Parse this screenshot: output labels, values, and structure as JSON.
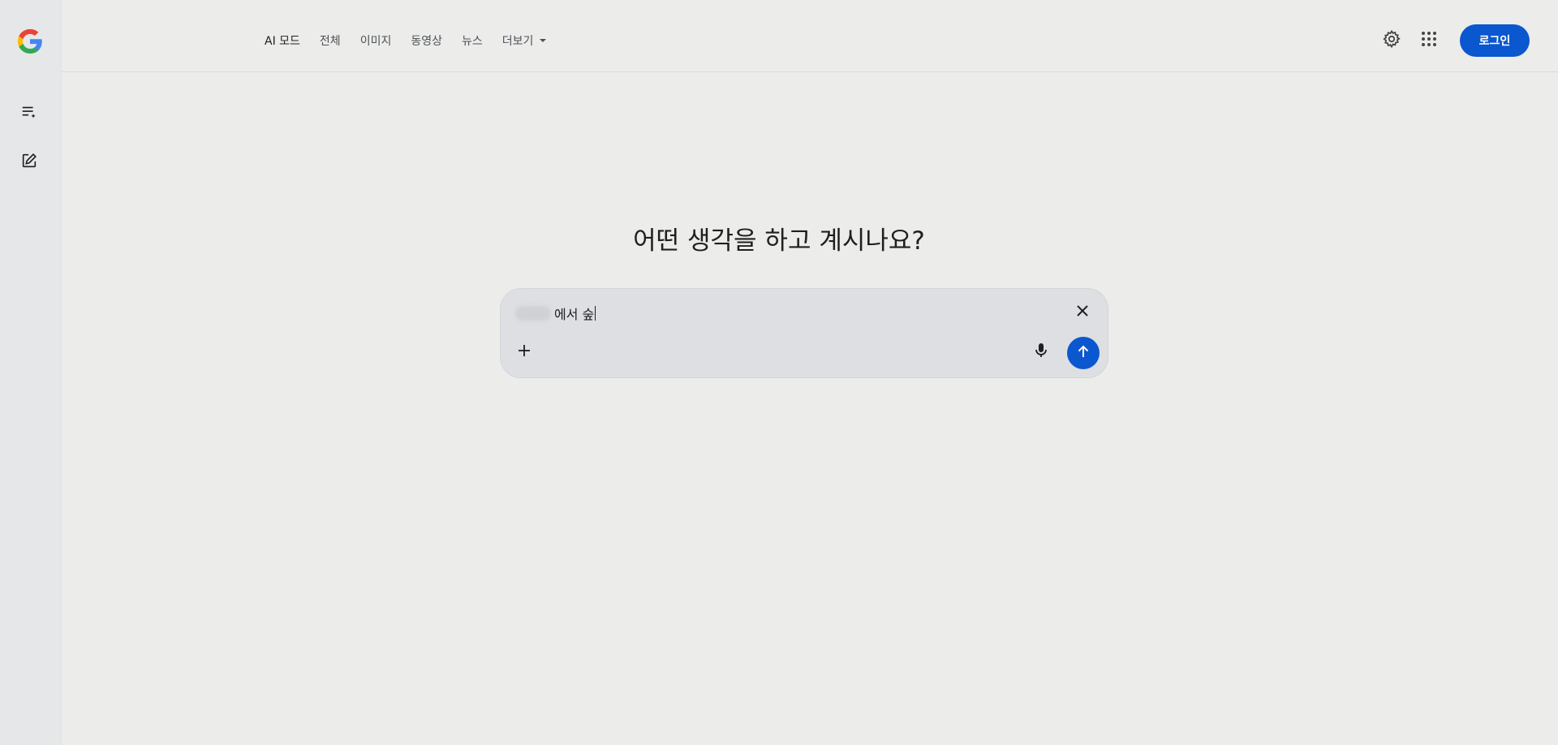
{
  "sidebar": {
    "logo_icon": "google-g-logo",
    "buttons": [
      {
        "icon": "history-list-icon",
        "name": "history-button"
      },
      {
        "icon": "new-chat-edit-icon",
        "name": "new-chat-button"
      }
    ]
  },
  "header": {
    "tabs": [
      {
        "label": "AI 모드",
        "active": true
      },
      {
        "label": "전체",
        "active": false
      },
      {
        "label": "이미지",
        "active": false
      },
      {
        "label": "동영상",
        "active": false
      },
      {
        "label": "뉴스",
        "active": false
      },
      {
        "label": "더보기",
        "active": false,
        "dropdown": true
      }
    ],
    "settings_icon": "gear-icon",
    "apps_icon": "apps-grid-icon",
    "login_label": "로그인"
  },
  "main": {
    "headline": "어떤 생각을 하고 계시나요?",
    "search": {
      "query_text": "에서 숲",
      "clear_icon": "close-icon",
      "add_icon": "plus-icon",
      "mic_icon": "microphone-icon",
      "send_icon": "arrow-up-icon"
    }
  },
  "colors": {
    "accent": "#0b57d0",
    "background": "#ececeb",
    "sidebar": "#e6e7e8",
    "search_box": "#dddfe2"
  }
}
